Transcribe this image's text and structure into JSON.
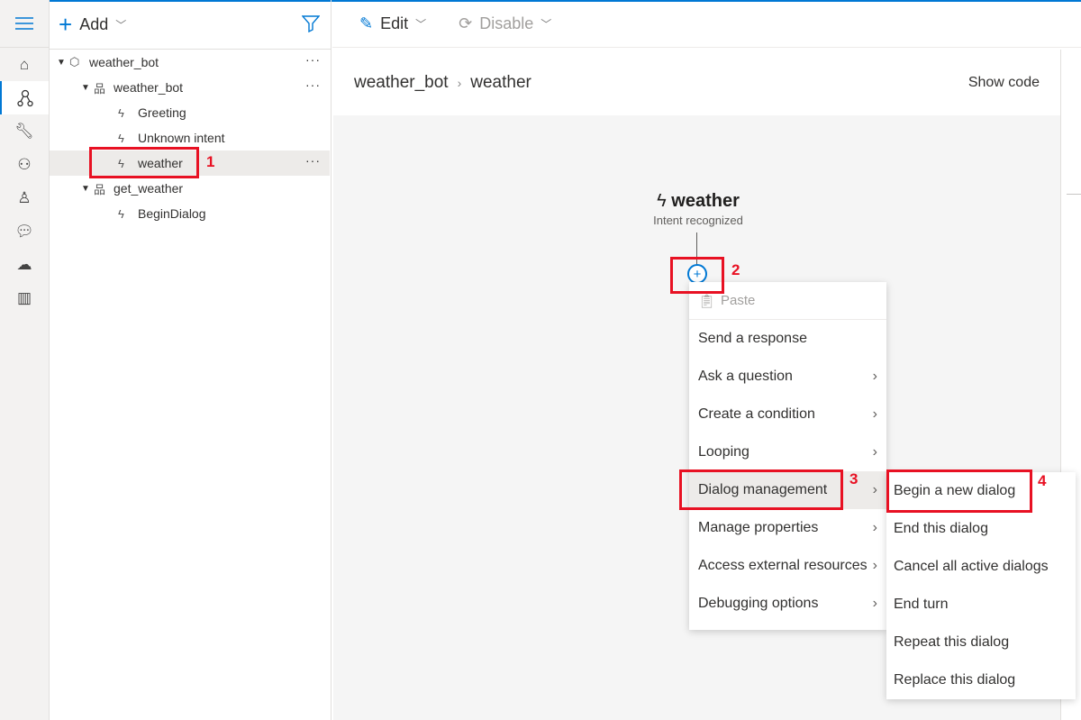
{
  "colors": {
    "accent": "#0078d4",
    "annotation": "#e81123"
  },
  "rail": {
    "items": [
      "menu-icon",
      "home-icon",
      "design-icon",
      "wrench-icon",
      "users-icon",
      "bot-icon",
      "chat-icon",
      "cloud-upload-icon",
      "library-icon"
    ]
  },
  "tree": {
    "add_label": "Add",
    "items": [
      {
        "label": "weather_bot",
        "icon": "cube-icon",
        "level": 0,
        "expanded": true,
        "more": "···"
      },
      {
        "label": "weather_bot",
        "icon": "dialog-icon",
        "level": 1,
        "expanded": true,
        "more": "···"
      },
      {
        "label": "Greeting",
        "icon": "trigger-icon",
        "level": 2
      },
      {
        "label": "Unknown intent",
        "icon": "trigger-icon",
        "level": 2
      },
      {
        "label": "weather",
        "icon": "trigger-icon",
        "level": 2,
        "selected": true,
        "more": "···"
      },
      {
        "label": "get_weather",
        "icon": "dialog-icon",
        "level": 1,
        "expanded": true
      },
      {
        "label": "BeginDialog",
        "icon": "trigger-icon",
        "level": 2
      }
    ]
  },
  "toolbar": {
    "edit_label": "Edit",
    "disable_label": "Disable"
  },
  "header": {
    "breadcrumb": [
      "weather_bot",
      "weather"
    ],
    "show_code": "Show code"
  },
  "node": {
    "title": "weather",
    "subtitle": "Intent recognized"
  },
  "menu": {
    "paste": "Paste",
    "items": [
      {
        "label": "Send a response",
        "submenu": false
      },
      {
        "label": "Ask a question",
        "submenu": true
      },
      {
        "label": "Create a condition",
        "submenu": true
      },
      {
        "label": "Looping",
        "submenu": true
      },
      {
        "label": "Dialog management",
        "submenu": true,
        "highlighted": true
      },
      {
        "label": "Manage properties",
        "submenu": true
      },
      {
        "label": "Access external resources",
        "submenu": true
      },
      {
        "label": "Debugging options",
        "submenu": true
      }
    ]
  },
  "submenu": {
    "items": [
      "Begin a new dialog",
      "End this dialog",
      "Cancel all active dialogs",
      "End turn",
      "Repeat this dialog",
      "Replace this dialog"
    ]
  },
  "annotations": [
    "1",
    "2",
    "3",
    "4"
  ]
}
